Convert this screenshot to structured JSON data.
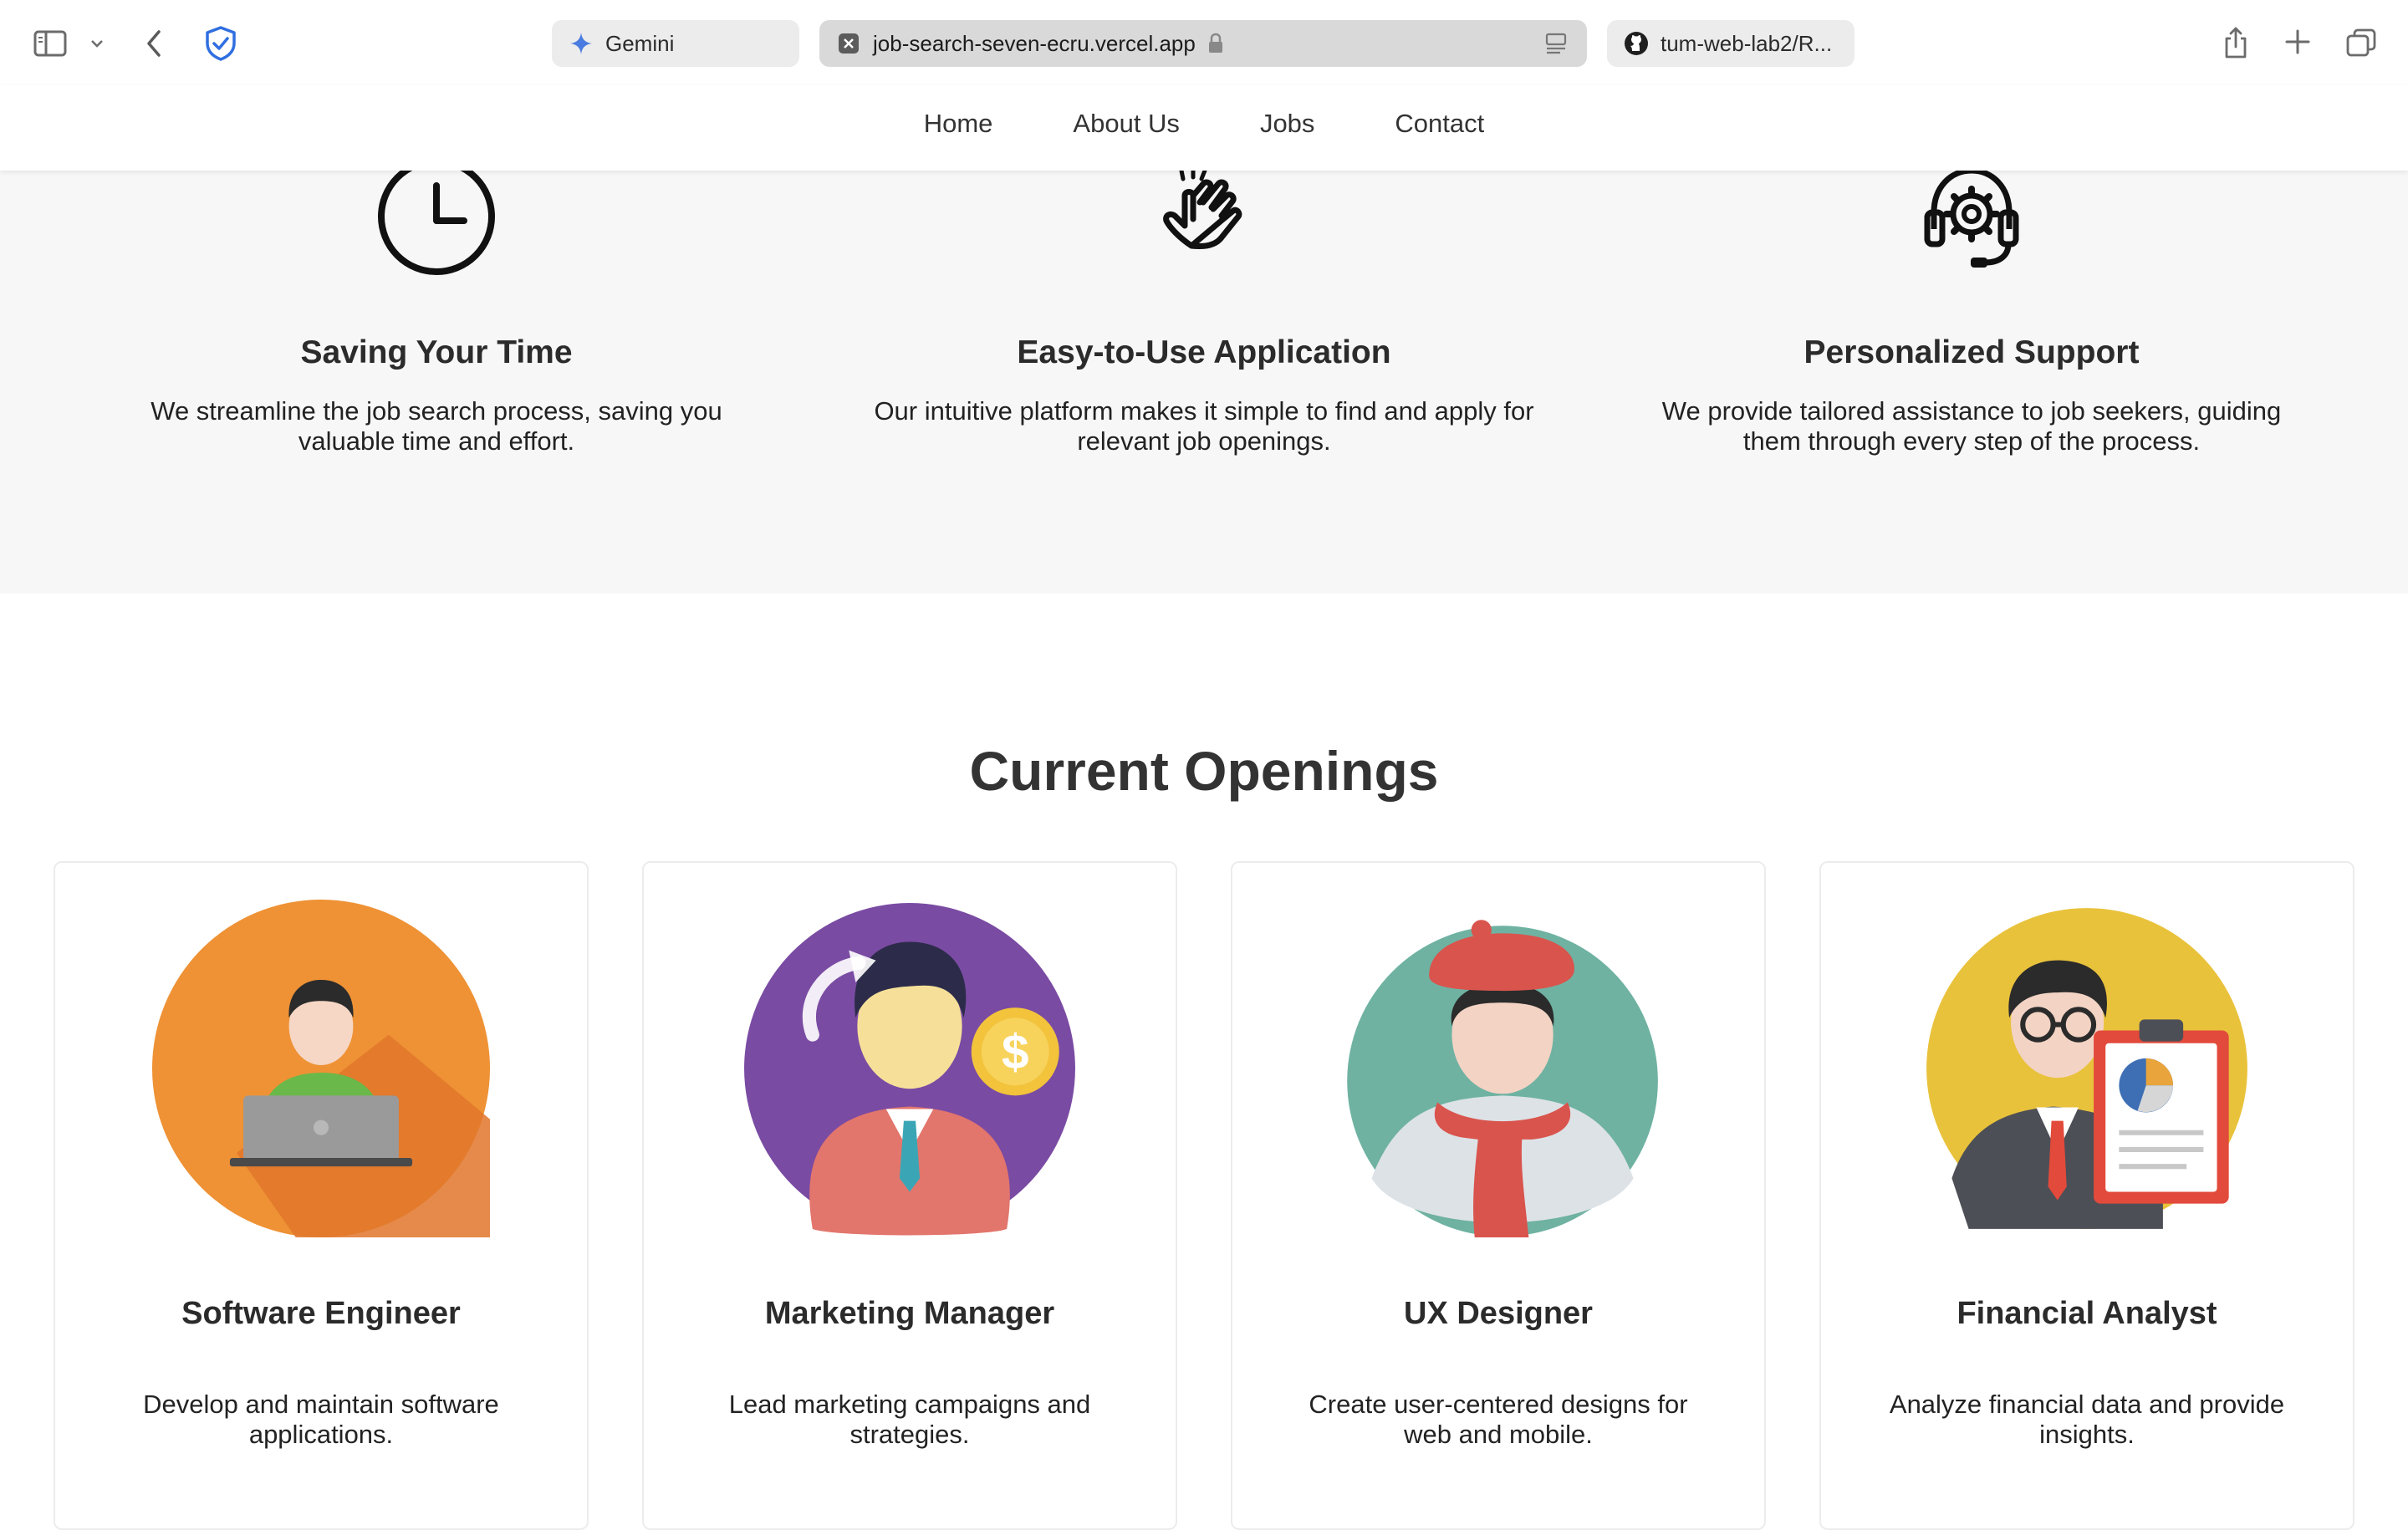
{
  "browser": {
    "tabs": [
      {
        "label": "Gemini"
      },
      {
        "label": "job-search-seven-ecru.vercel.app"
      },
      {
        "label": "tum-web-lab2/R..."
      }
    ]
  },
  "nav": {
    "links": [
      "Home",
      "About Us",
      "Jobs",
      "Contact"
    ]
  },
  "features": [
    {
      "icon": "clock-icon",
      "title": "Saving Your Time",
      "text": "We streamline the job search process, saving you valuable time and effort."
    },
    {
      "icon": "hand-tap-icon",
      "title": "Easy-to-Use Application",
      "text": "Our intuitive platform makes it simple to find and apply for relevant job openings."
    },
    {
      "icon": "headset-gear-icon",
      "title": "Personalized Support",
      "text": "We provide tailored assistance to job seekers, guiding them through every step of the process."
    }
  ],
  "openings": {
    "title": "Current Openings",
    "jobs": [
      {
        "title": "Software Engineer",
        "text": "Develop and maintain software applications.",
        "color": "#ee9235"
      },
      {
        "title": "Marketing Manager",
        "text": "Lead marketing campaigns and strategies.",
        "color": "#7a4ba3"
      },
      {
        "title": "UX Designer",
        "text": "Create user-centered designs for web and mobile.",
        "color": "#6fb2a2"
      },
      {
        "title": "Financial Analyst",
        "text": "Analyze financial data and provide insights.",
        "color": "#e9c23b"
      }
    ]
  }
}
